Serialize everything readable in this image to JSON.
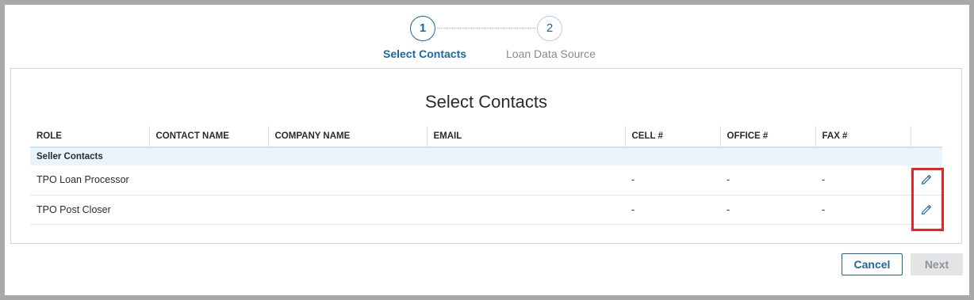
{
  "stepper": {
    "steps": [
      {
        "number": "1",
        "label": "Select Contacts"
      },
      {
        "number": "2",
        "label": "Loan Data Source"
      }
    ]
  },
  "panel": {
    "title": "Select Contacts"
  },
  "table": {
    "columns": [
      "ROLE",
      "CONTACT NAME",
      "COMPANY NAME",
      "EMAIL",
      "CELL #",
      "OFFICE #",
      "FAX #",
      ""
    ],
    "group_label": "Seller Contacts",
    "rows": [
      {
        "role": "TPO Loan Processor",
        "contact_name": "",
        "company_name": "",
        "email": "",
        "cell": "-",
        "office": "-",
        "fax": "-"
      },
      {
        "role": "TPO Post Closer",
        "contact_name": "",
        "company_name": "",
        "email": "",
        "cell": "-",
        "office": "-",
        "fax": "-"
      }
    ]
  },
  "footer": {
    "cancel_label": "Cancel",
    "next_label": "Next"
  },
  "colors": {
    "accent": "#1a67a3",
    "highlight": "#e8242a",
    "group_row_bg": "#eaf4fc"
  },
  "icons": {
    "row_action": "pencil-edit-icon"
  }
}
